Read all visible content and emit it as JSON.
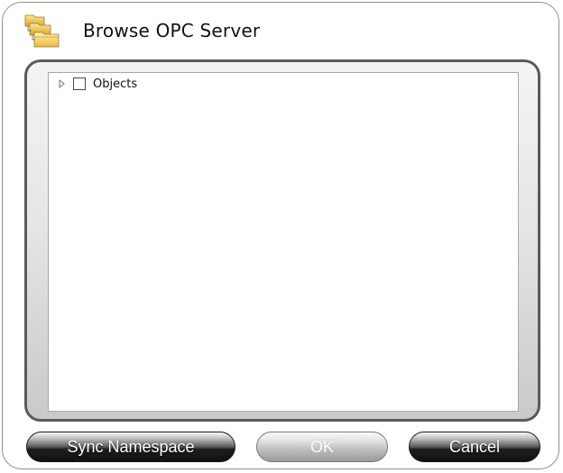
{
  "dialog": {
    "title": "Browse OPC Server",
    "title_icon": "folders-icon"
  },
  "tree": {
    "nodes": [
      {
        "label": "Objects",
        "expanded": false,
        "checked": false
      }
    ]
  },
  "buttons": {
    "sync_label": "Sync Namespace",
    "ok_label": "OK",
    "ok_enabled": false,
    "cancel_label": "Cancel"
  },
  "colors": {
    "frame_border": "#5a5a5a",
    "button_dark": "#1e1e1e",
    "button_disabled": "#bdbdbd"
  }
}
